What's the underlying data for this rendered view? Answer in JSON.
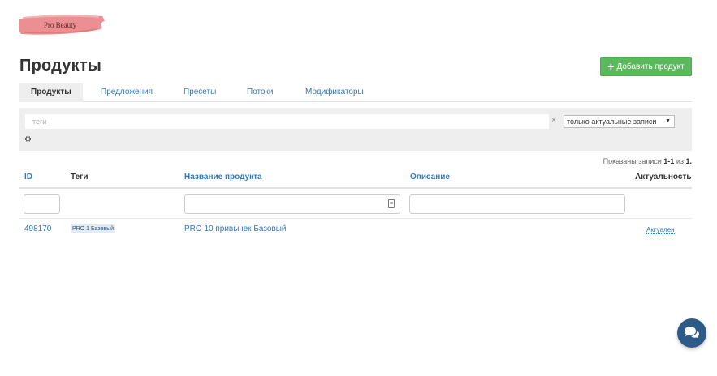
{
  "brand": {
    "logo_text": "Pro Beauty"
  },
  "page": {
    "title": "Продукты"
  },
  "actions": {
    "add_product_label": "Добавить продукт"
  },
  "tabs": [
    {
      "label": "Продукты",
      "active": true
    },
    {
      "label": "Предложения"
    },
    {
      "label": "Пресеты"
    },
    {
      "label": "Потоки"
    },
    {
      "label": "Модификаторы"
    }
  ],
  "filters": {
    "tags_placeholder": "теги",
    "status_selected": "только актуальные записи"
  },
  "records": {
    "prefix": "Показаны записи",
    "range": "1-1",
    "of": "из",
    "total": "1."
  },
  "table": {
    "columns": {
      "id": "ID",
      "tags": "Теги",
      "name": "Название продукта",
      "description": "Описание",
      "status": "Актуальность"
    },
    "rows": [
      {
        "id": "498170",
        "tag": "PRO 1 Базовый",
        "name": "PRO 10 привычек Базовый",
        "status": "Актуален"
      }
    ]
  },
  "colors": {
    "accent": "#337ab7",
    "success": "#5cb85c",
    "chat": "#2c5b87",
    "logo_brush": "#ec8f92"
  },
  "icons": {
    "add": "plus-icon",
    "settings": "gear-icon",
    "clear": "close-icon",
    "filter": "filter-icon",
    "chat": "chat-icon"
  }
}
